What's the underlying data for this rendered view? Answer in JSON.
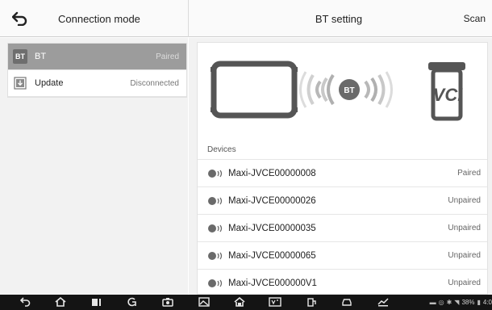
{
  "header": {
    "title": "Connection mode",
    "center_title": "BT setting",
    "scan_label": "Scan"
  },
  "modes": [
    {
      "icon": "bt-icon",
      "icon_text": "BT",
      "label": "BT",
      "status": "Paired",
      "active": true
    },
    {
      "icon": "update-icon",
      "icon_text": "",
      "label": "Update",
      "status": "Disconnected",
      "active": false
    }
  ],
  "illustration": {
    "bt_text": "BT",
    "vci_text": "VCI"
  },
  "devices": {
    "label": "Devices",
    "items": [
      {
        "name": "Maxi-JVCE00000008",
        "status": "Paired"
      },
      {
        "name": "Maxi-JVCE00000026",
        "status": "Unpaired"
      },
      {
        "name": "Maxi-JVCE00000035",
        "status": "Unpaired"
      },
      {
        "name": "Maxi-JVCE00000065",
        "status": "Unpaired"
      },
      {
        "name": "Maxi-JVCE000000V1",
        "status": "Unpaired"
      }
    ]
  },
  "statusbar": {
    "battery": "38%",
    "time": "4:0"
  },
  "colors": {
    "active_row": "#9c9c9c",
    "bar": "#141414"
  }
}
